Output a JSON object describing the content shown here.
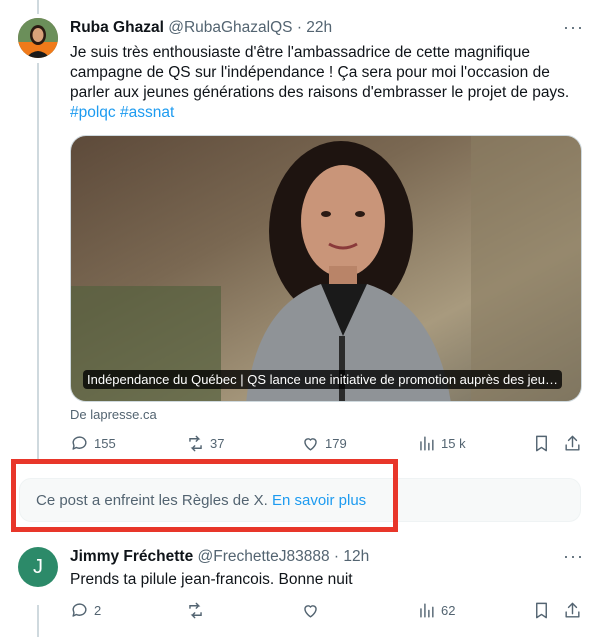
{
  "tweet1": {
    "author_name": "Ruba Ghazal",
    "handle": "@RubaGhazalQS",
    "separator": "·",
    "time": "22h",
    "more_label": "···",
    "text": "Je suis très enthousiaste d'être l'ambassadrice de cette magnifique campagne de QS sur l'indépendance !  Ça sera pour moi l'occasion de parler aux jeunes générations des raisons d'embrasser le projet de pays.",
    "hashtags": [
      "#polqc",
      "#assnat"
    ],
    "card_caption": "Indépendance du Québec | QS lance une initiative de promotion auprès des jeu…",
    "card_source": "De lapresse.ca",
    "stats": {
      "replies": "155",
      "reposts": "37",
      "likes": "179",
      "views": "15 k"
    }
  },
  "notice": {
    "text": "Ce post a enfreint les Règles de X.",
    "link": "En savoir plus"
  },
  "tweet2": {
    "author_name": "Jimmy Fréchette",
    "handle": "@FrechetteJ83888",
    "separator": "·",
    "time": "12h",
    "avatar_initial": "J",
    "more_label": "···",
    "text": "Prends ta pilule jean-francois. Bonne nuit",
    "stats": {
      "replies": "2",
      "reposts": "",
      "likes": "",
      "views": "62"
    }
  },
  "colors": {
    "accent": "#1d9bf0",
    "secondary_text": "#536471",
    "highlight": "#e8362a",
    "avatar2": "#2c8a69"
  }
}
